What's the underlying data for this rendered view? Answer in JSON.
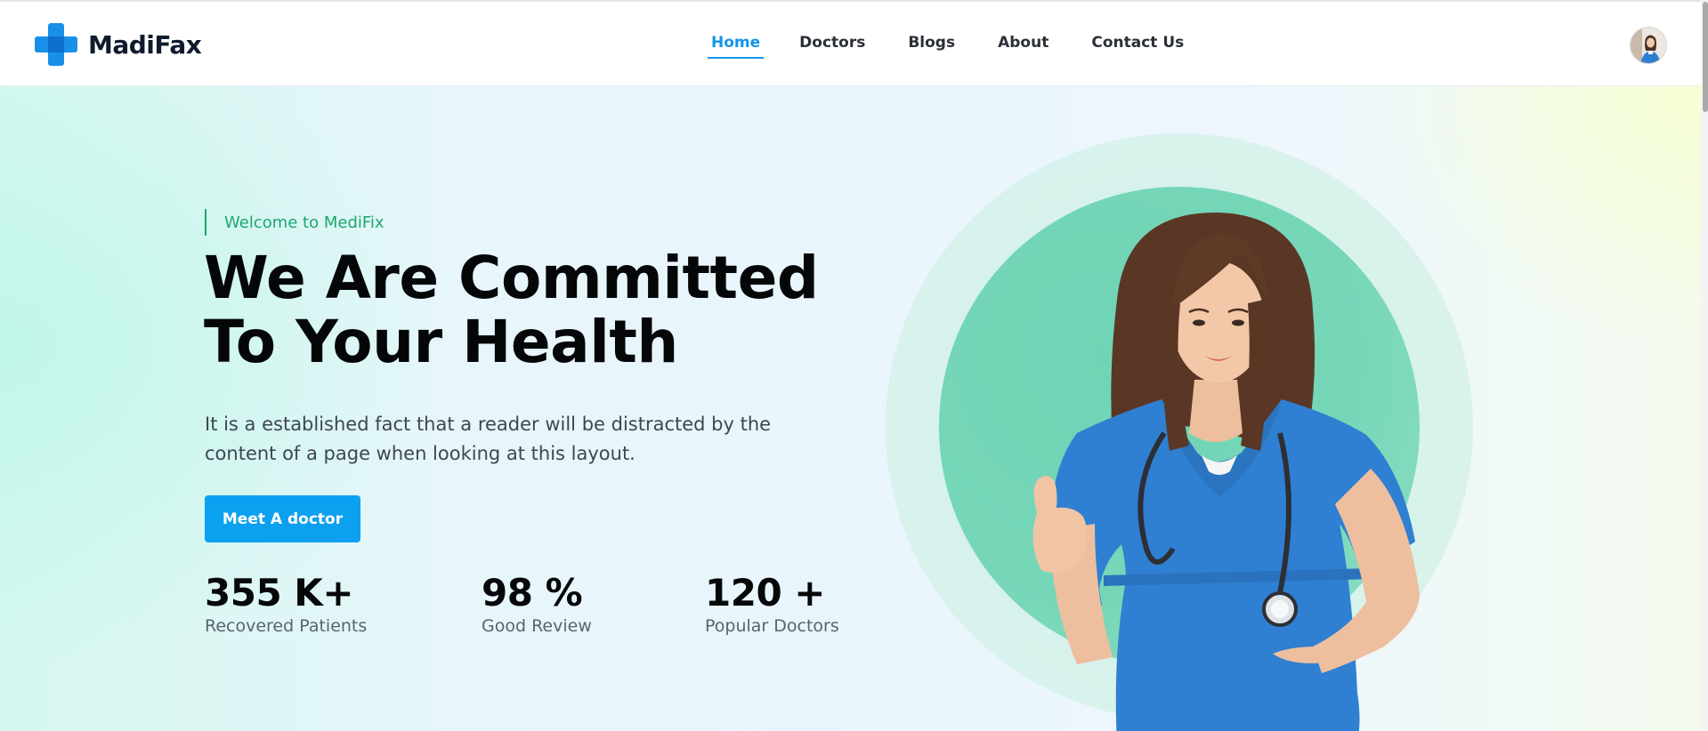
{
  "brand": {
    "name": "MadiFax",
    "logo_icon": "medical-cross-icon",
    "color": "#1296e8"
  },
  "nav": {
    "items": [
      {
        "label": "Home",
        "active": true
      },
      {
        "label": "Doctors",
        "active": false
      },
      {
        "label": "Blogs",
        "active": false
      },
      {
        "label": "About",
        "active": false
      },
      {
        "label": "Contact Us",
        "active": false
      }
    ],
    "active_color": "#1296e8"
  },
  "user": {
    "avatar_icon": "user-avatar-icon"
  },
  "hero": {
    "eyebrow": "Welcome to MediFix",
    "headline_line1": "We Are Committed",
    "headline_line2": "To Your Health",
    "lede": "It is a established fact that a reader will be distracted by the content of a page when looking at this layout.",
    "cta_label": "Meet A doctor",
    "cta_color": "#0ca0f0",
    "accent_color": "#1ca76f",
    "illustration": "doctor-thumbs-up-illustration"
  },
  "stats": [
    {
      "value": "355 K+",
      "label": "Recovered Patients"
    },
    {
      "value": "98 %",
      "label": "Good Review"
    },
    {
      "value": "120 +",
      "label": "Popular Doctors"
    }
  ]
}
